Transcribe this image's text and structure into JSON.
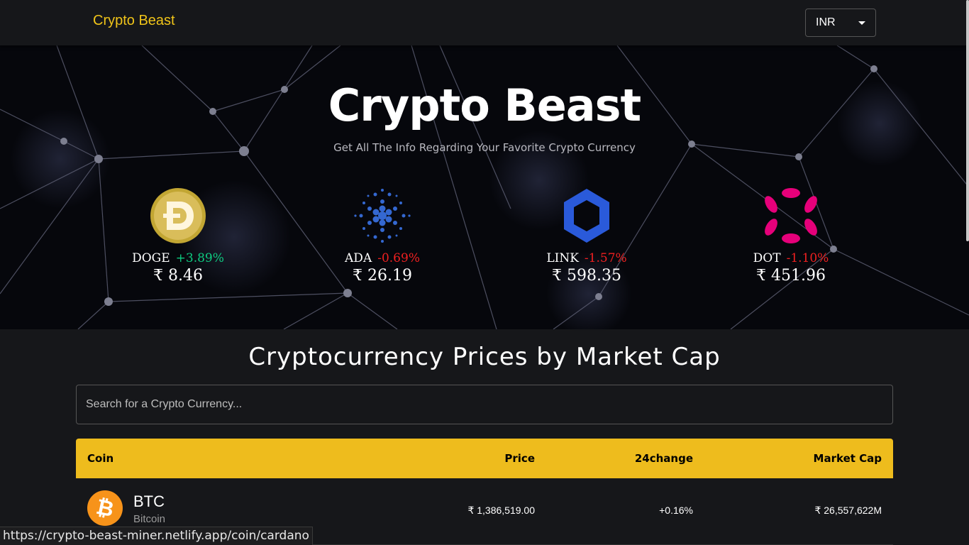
{
  "app": {
    "brand": "Crypto Beast"
  },
  "currency": {
    "selected": "INR"
  },
  "hero": {
    "title": "Crypto Beast",
    "subtitle": "Get All The Info Regarding Your Favorite Crypto Currency"
  },
  "trending": [
    {
      "symbol": "DOGE",
      "change": "+3.89%",
      "price": "₹ 8.46",
      "icon": "doge-logo-icon"
    },
    {
      "symbol": "ADA",
      "change": "-0.69%",
      "price": "₹ 26.19",
      "icon": "cardano-logo-icon"
    },
    {
      "symbol": "LINK",
      "change": "-1.57%",
      "price": "₹ 598.35",
      "icon": "chainlink-logo-icon"
    },
    {
      "symbol": "DOT",
      "change": "-1.10%",
      "price": "₹ 451.96",
      "icon": "polkadot-logo-icon"
    }
  ],
  "colors": {
    "accent": "#eebc1d",
    "brand": "#f0c419",
    "positive": "#0ecb81",
    "negative": "#f02020"
  },
  "market": {
    "title": "Cryptocurrency Prices by Market Cap",
    "search_placeholder": "Search for a Crypto Currency...",
    "columns": [
      "Coin",
      "Price",
      "24change",
      "Market Cap"
    ],
    "rows": [
      {
        "symbol": "BTC",
        "name": "Bitcoin",
        "price": "₹ 1,386,519.00",
        "change": "+0.16%",
        "market_cap": "₹ 26,557,622M",
        "icon": "bitcoin-logo-icon"
      }
    ]
  },
  "status_url": "https://crypto-beast-miner.netlify.app/coin/cardano"
}
